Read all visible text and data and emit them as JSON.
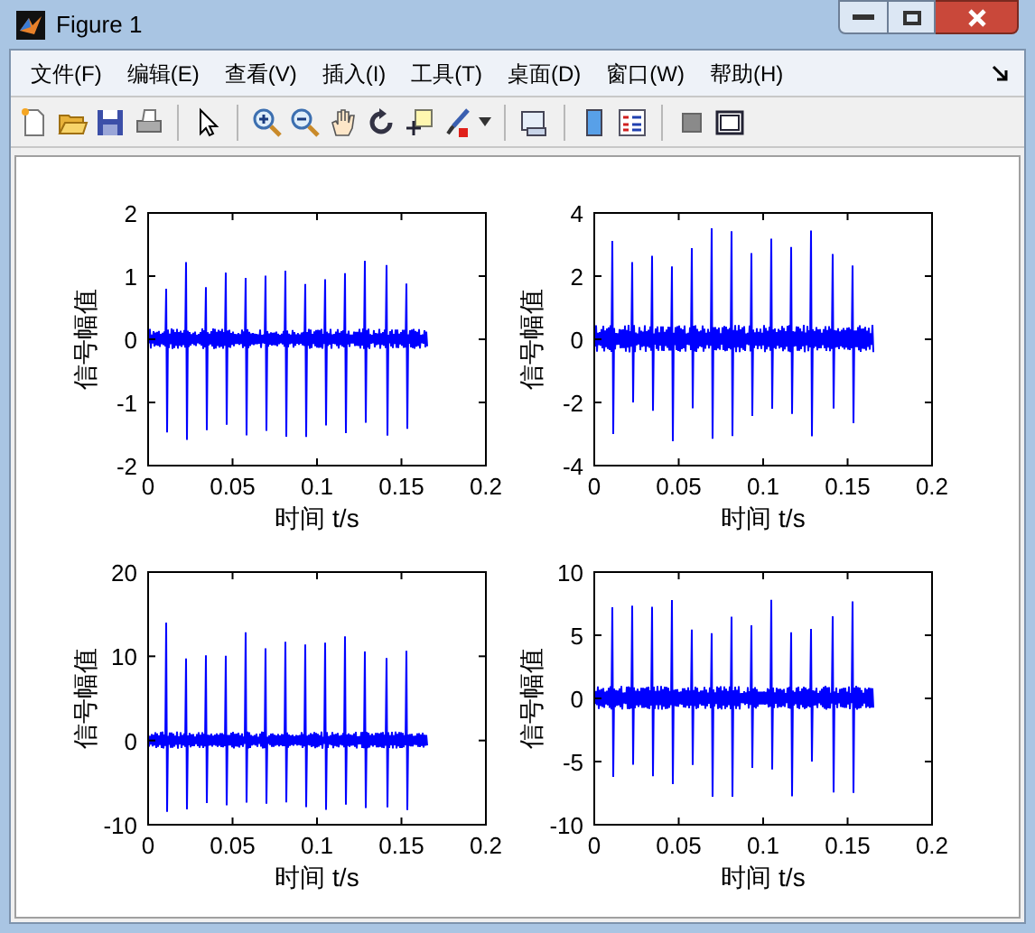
{
  "window": {
    "title": "Figure 1"
  },
  "menu": [
    "文件(F)",
    "编辑(E)",
    "查看(V)",
    "插入(I)",
    "工具(T)",
    "桌面(D)",
    "窗口(W)",
    "帮助(H)"
  ],
  "subplots": [
    {
      "ylabel": "信号幅值",
      "xlabel": "时间 t/s",
      "xticks": [
        "0",
        "0.05",
        "0.1",
        "0.15",
        "0.2"
      ],
      "yticks": [
        "2",
        "1",
        "0",
        "-1",
        "-2"
      ]
    },
    {
      "ylabel": "信号幅值",
      "xlabel": "时间 t/s",
      "xticks": [
        "0",
        "0.05",
        "0.1",
        "0.15",
        "0.2"
      ],
      "yticks": [
        "4",
        "2",
        "0",
        "-2",
        "-4"
      ]
    },
    {
      "ylabel": "信号幅值",
      "xlabel": "时间 t/s",
      "xticks": [
        "0",
        "0.05",
        "0.1",
        "0.15",
        "0.2"
      ],
      "yticks": [
        "20",
        "10",
        "0",
        "-10"
      ]
    },
    {
      "ylabel": "信号幅值",
      "xlabel": "时间 t/s",
      "xticks": [
        "0",
        "0.05",
        "0.1",
        "0.15",
        "0.2"
      ],
      "yticks": [
        "10",
        "5",
        "0",
        "-5",
        "-10"
      ]
    }
  ]
}
